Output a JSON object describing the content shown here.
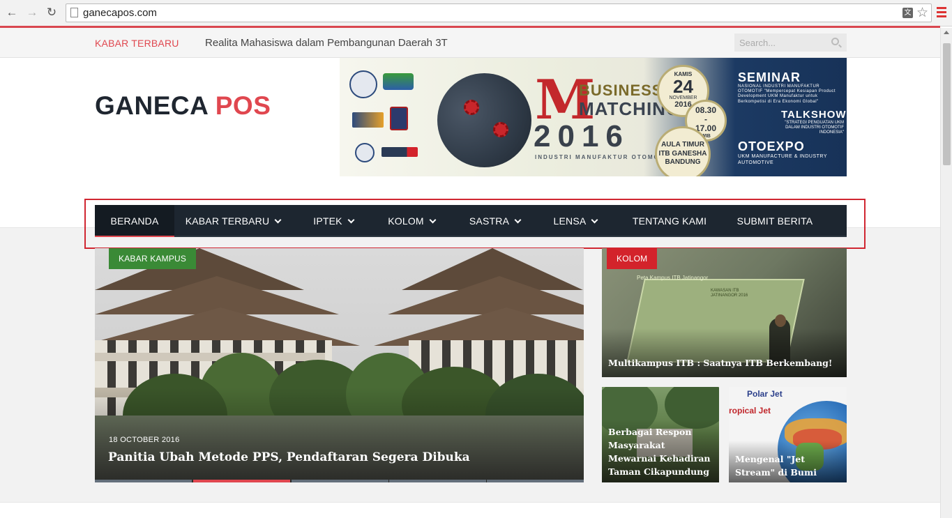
{
  "browser": {
    "url": "ganecapos.com",
    "icons": [
      "back-icon",
      "forward-icon",
      "reload-icon",
      "page-icon",
      "translate-icon",
      "star-icon",
      "menu-icon"
    ]
  },
  "topbar": {
    "ticker_label": "KABAR TERBARU",
    "ticker_text": "Realita Mahasiswa dalam Pembangunan Daerah 3T",
    "search_placeholder": "Search..."
  },
  "logo": {
    "part1": "GANECA",
    "part2": " POS"
  },
  "banner": {
    "m": "M",
    "business": "BUSINESS",
    "matching": "MATCHING",
    "year": "2016",
    "subtitle": "INDUSTRI MANUFAKTUR OTOMOTIF",
    "day": "KAMIS",
    "date_num": "24",
    "month": "NOVEMBER",
    "date_year": "2016",
    "time1": "08.30",
    "time_sep": "-",
    "time2": "17.00",
    "time_zone": "WIB",
    "place": "AULA TIMUR ITB GANESHA BANDUNG",
    "seminar": "SEMINAR",
    "seminar_sub": "NASIONAL INDUSTRI MANUFAKTUR OTOMOTIF \"Mempercepat Kesiapan Product Development UKM Manufaktur untuk Berkompetisi di Era Ekonomi Global\"",
    "talkshow": "TALKSHOW",
    "talkshow_sub": "\"STRATEGI PENGUATAN UKM DALAM INDUSTRI OTOMOTIF INDONESIA\"",
    "otoexpo": "OTOEXPO",
    "otoexpo_sub": "UKM MANUFACTURE & INDUSTRY AUTOMOTIVE"
  },
  "nav": {
    "items": [
      {
        "label": "BERANDA"
      },
      {
        "label": "KABAR TERBARU"
      },
      {
        "label": "IPTEK"
      },
      {
        "label": "KOLOM"
      },
      {
        "label": "SASTRA"
      },
      {
        "label": "LENSA"
      },
      {
        "label": "TENTANG KAMI"
      },
      {
        "label": "SUBMIT BERITA"
      }
    ]
  },
  "hero": {
    "category": "KABAR KAMPUS",
    "category_color": "#3a8a36",
    "date": "18 OCTOBER 2016",
    "title": "Panitia Ubah Metode PPS, Pendaftaran Segera Dibuka"
  },
  "side": {
    "card1": {
      "category": "KOLOM",
      "category_color": "#d3232b",
      "title": "Multikampus ITB : Saatnya ITB Berkembang!",
      "slide_heading": "Peta Kampus ITB Jatinangor",
      "slide_label": "KAWASAN ITB JATINANGOR 2016"
    },
    "card2": {
      "title": "Berbagai Respon Masyarakat Mewarnai Kehadiran Taman Cikapundung"
    },
    "card3": {
      "title": "Mengenal \"Jet Stream\" di Bumi",
      "label1": "Polar Jet",
      "label2": "ropical Jet"
    }
  },
  "colors": {
    "accent": "#e0474f",
    "nav_bg": "#1d2630",
    "highlight_box": "#d02631"
  }
}
